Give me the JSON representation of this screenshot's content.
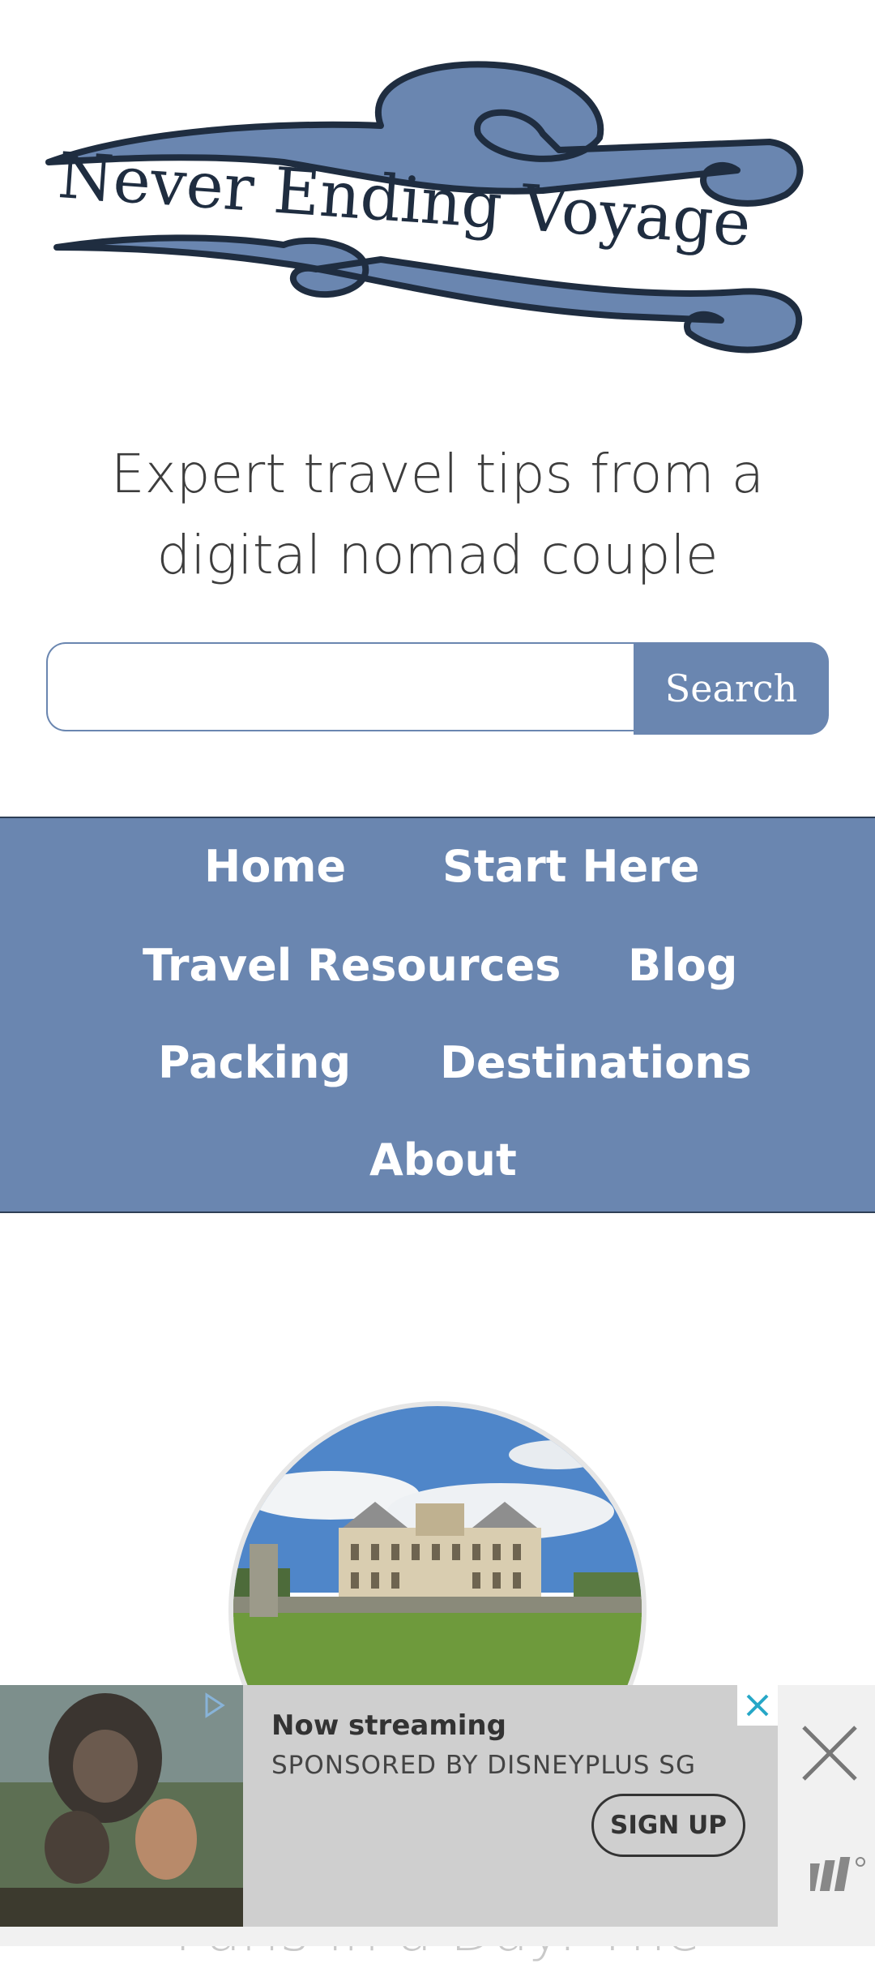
{
  "header": {
    "logo_text": "Never Ending Voyage",
    "tagline_line1": "Expert travel tips from a",
    "tagline_line2": "digital nomad couple"
  },
  "search": {
    "placeholder": "",
    "button_label": "Search"
  },
  "nav": {
    "items": [
      {
        "label": "Home"
      },
      {
        "label": "Start Here"
      },
      {
        "label": "Travel Resources"
      },
      {
        "label": "Blog"
      },
      {
        "label": "Packing"
      },
      {
        "label": "Destinations"
      },
      {
        "label": "About"
      }
    ]
  },
  "post": {
    "title_partial": "Paris in a Day: The"
  },
  "ad": {
    "headline": "Now streaming",
    "sponsor": "SPONSORED BY DISNEYPLUS SG",
    "cta": "SIGN UP"
  },
  "colors": {
    "accent": "#6a86b0",
    "nav_border": "#2e3f56",
    "logo_text": "#1f2d40"
  }
}
